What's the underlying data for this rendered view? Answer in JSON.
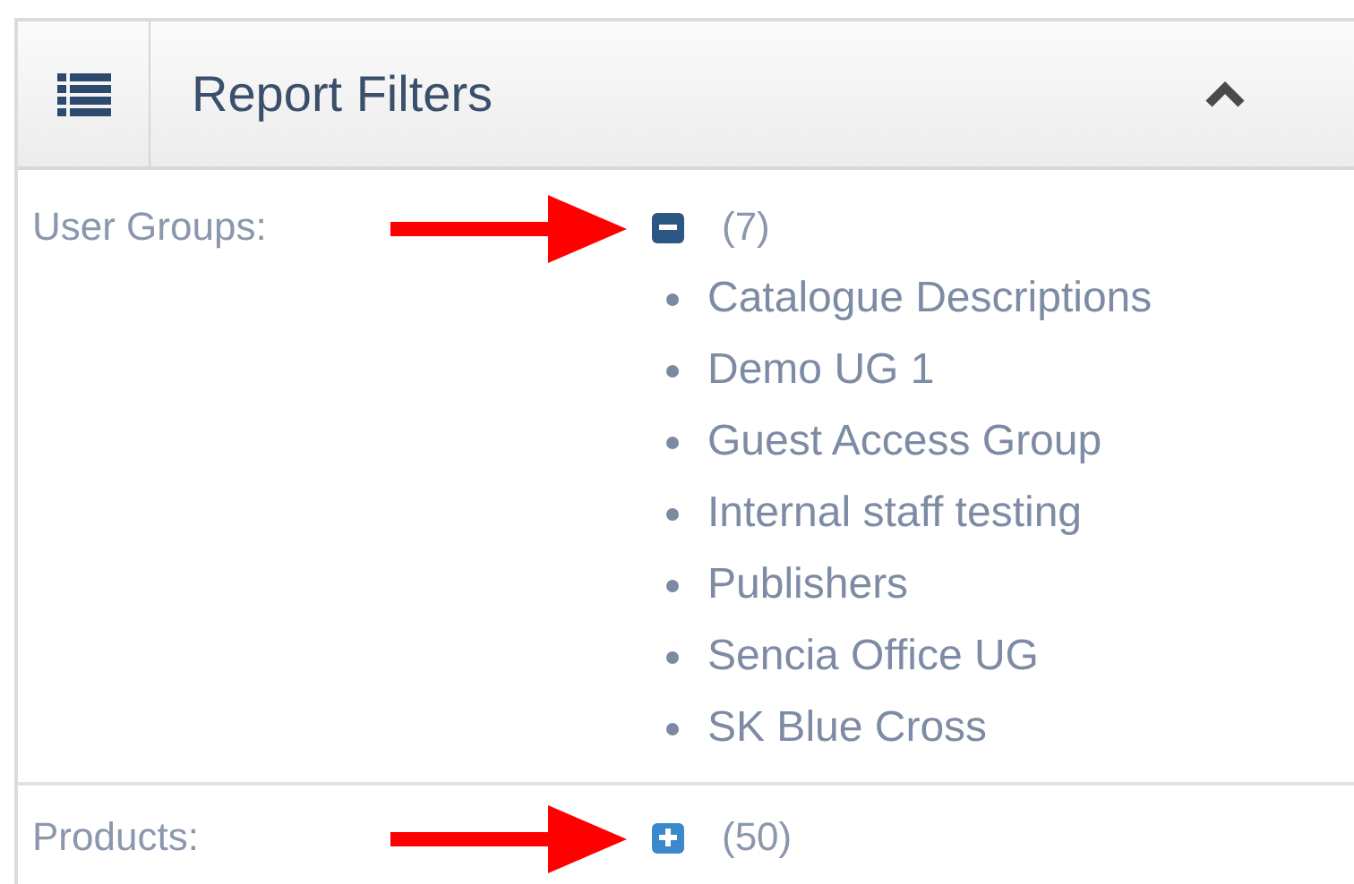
{
  "panel": {
    "title": "Report Filters",
    "expanded": true
  },
  "filters": [
    {
      "label": "User Groups:",
      "expanded": true,
      "count": "(7)",
      "items": [
        "Catalogue Descriptions",
        "Demo UG 1",
        "Guest Access Group",
        "Internal staff testing",
        "Publishers",
        "Sencia Office UG",
        "SK Blue Cross"
      ]
    },
    {
      "label": "Products:",
      "expanded": false,
      "count": "(50)"
    }
  ]
}
